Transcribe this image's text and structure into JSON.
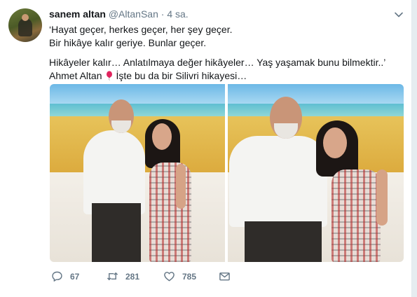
{
  "tweet": {
    "name": "sanem altan",
    "handle": "@AltanSan",
    "separator": "·",
    "time": "4 sa.",
    "lines": [
      "‘Hayat geçer, herkes geçer, her şey geçer.",
      "Bir hikâye kalır geriye.  Bunlar geçer.",
      "Hikâyeler kalır… Anlatılmaya değer hikâyeler… Yaş yaşamak bunu bilmektir..’"
    ],
    "last_line_before": "Ahmet Altan",
    "last_line_after": "İşte bu da bir Silivri hikayesi…",
    "emoji": "balloon-icon"
  },
  "actions": {
    "reply_count": "67",
    "retweet_count": "281",
    "like_count": "785"
  },
  "colors": {
    "text": "#14171a",
    "muted": "#657786",
    "balloon": "#e0245e"
  }
}
